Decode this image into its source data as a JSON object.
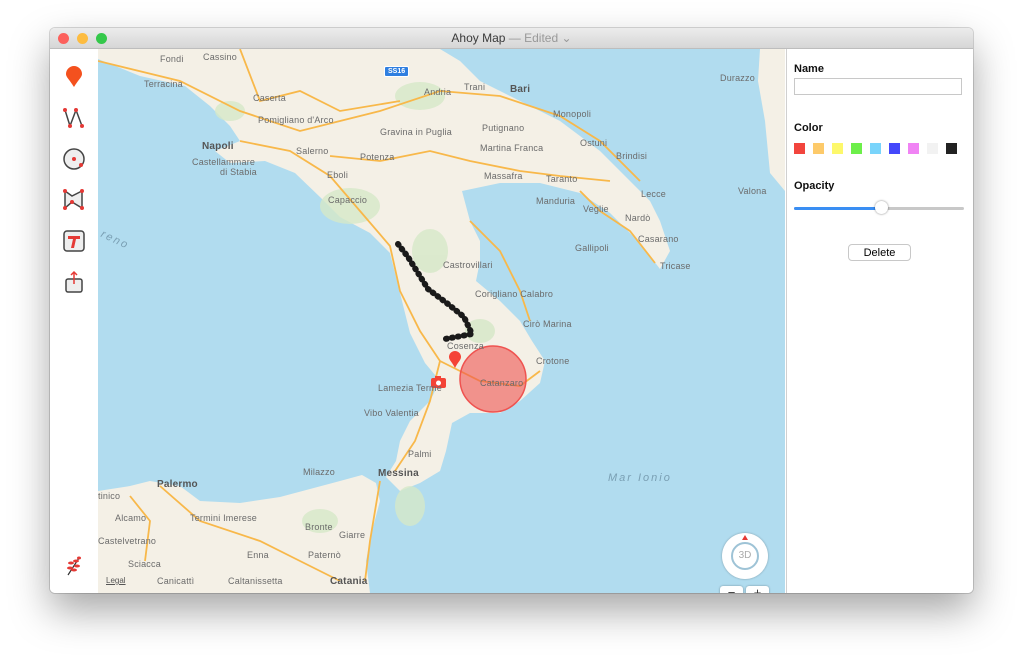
{
  "window": {
    "title": "Ahoy Map",
    "separator": " — ",
    "status": "Edited",
    "status_chevron": "⌄"
  },
  "toolbar": {
    "tools": [
      "pin-tool-icon",
      "polyline-tool-icon",
      "circle-tool-icon",
      "polygon-tool-icon",
      "text-tool-icon",
      "share-icon"
    ],
    "bottom_icon": "branch-logo-icon"
  },
  "map": {
    "road_shield": "SS16",
    "legal": "Legal",
    "compass_label": "3D",
    "zoom_out": "−",
    "zoom_in": "+",
    "labels": [
      "Fondi",
      "Cassino",
      "Terracina",
      "Caserta",
      "Pomigliano d'Arco",
      "Napoli",
      "Castellammare",
      "di Stabia",
      "Salerno",
      "Eboli",
      "Capaccio",
      "Potenza",
      "Gravina in Puglia",
      "Andria",
      "Trani",
      "Bari",
      "Monopoli",
      "Putignano",
      "Martina Franca",
      "Ostuni",
      "Brindisi",
      "Massafra",
      "Taranto",
      "Manduria",
      "Veglie",
      "Lecce",
      "Nardò",
      "Gallipoli",
      "Casarano",
      "Tricase",
      "Durazzo",
      "Valona",
      "Castrovillari",
      "Corigliano Calabro",
      "Cirò Marina",
      "Cosenza",
      "Crotone",
      "Catanzaro",
      "Lamezia Terme",
      "Vibo Valentia",
      "Palmi",
      "Milazzo",
      "Messina",
      "Palermo",
      "Alcamo",
      "Castelvetrano",
      "Termini Imerese",
      "Bronte",
      "Giarre",
      "Enna",
      "Paternò",
      "Sciacca",
      "Canicattì",
      "Caltanissetta",
      "Catania",
      "tinico",
      "Mar Ionio",
      "reno"
    ],
    "shape_color": "#ef5350",
    "route_color": "#1a1a1a"
  },
  "panel": {
    "name_label": "Name",
    "name_value": "",
    "color_label": "Color",
    "colors": [
      "#f2453d",
      "#fdca6a",
      "#fdf86b",
      "#6def4a",
      "#79d4fb",
      "#4448fb",
      "#f083f4",
      "#f2f2f2",
      "#222222"
    ],
    "opacity_label": "Opacity",
    "opacity": 0.52,
    "delete_label": "Delete"
  }
}
